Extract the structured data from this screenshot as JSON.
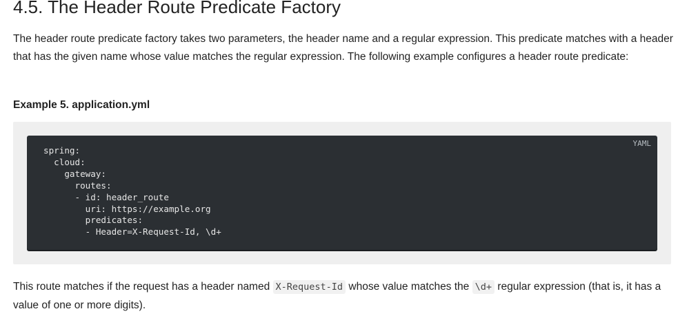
{
  "section": {
    "heading": "4.5. The Header Route Predicate Factory",
    "intro": "The header route predicate factory takes two parameters, the header name and a regular expression. This predicate matches with a header that has the given name whose value matches the regular expression. The following example configures a header route predicate:"
  },
  "example": {
    "title": "Example 5. application.yml",
    "language_label": "YAML",
    "code_lines": [
      "spring:",
      "  cloud:",
      "    gateway:",
      "      routes:",
      "      - id: header_route",
      "        uri: https://example.org",
      "        predicates:",
      "        - Header=X-Request-Id, \\d+"
    ]
  },
  "outro": {
    "part1": "This route matches if the request has a header named ",
    "code1": "X-Request-Id",
    "part2": " whose value matches the ",
    "code2": "\\d+",
    "part3": " regular expression (that is, it has a value of one or more digits)."
  }
}
